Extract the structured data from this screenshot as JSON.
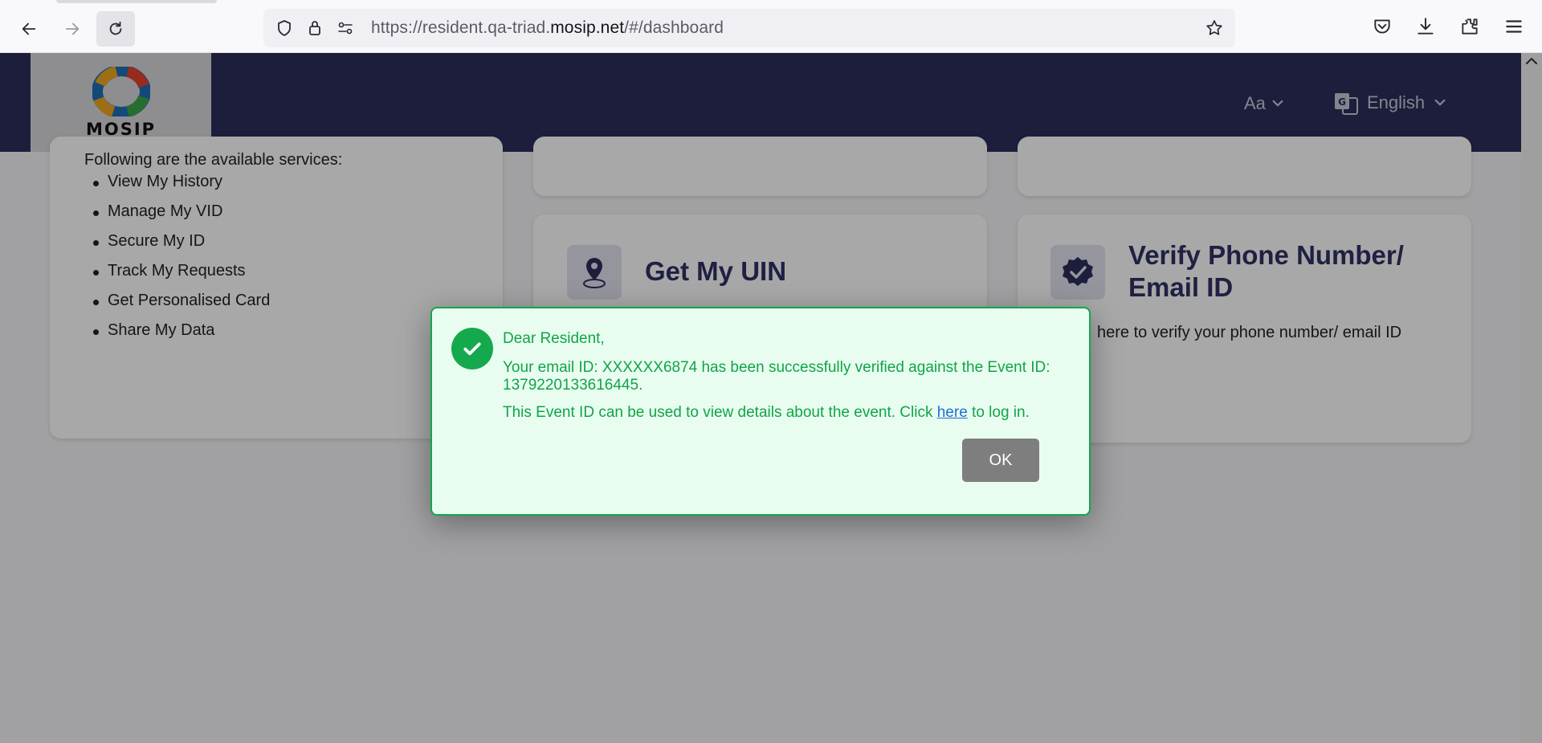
{
  "browser": {
    "url_prefix": "https://resident.qa-triad.",
    "url_domain": "mosip.net",
    "url_suffix": "/#/dashboard"
  },
  "header": {
    "logo_text": "MOSIP",
    "font_size_label": "Aa",
    "language_label": "English"
  },
  "services": {
    "intro": "Following are the available services:",
    "items": [
      "View My History",
      "Manage My VID",
      "Secure My ID",
      "Track My Requests",
      "Get Personalised Card",
      "Share My Data"
    ]
  },
  "cards": {
    "get_uin_title": "Get My UIN",
    "verify_title_line1": "Verify Phone Number/",
    "verify_title_line2": "Email ID",
    "verify_desc": "here to verify your phone number/ email ID"
  },
  "dialog": {
    "greeting": "Dear Resident,",
    "message_line1": "Your email ID: XXXXXX6874 has been successfully verified against the Event ID:",
    "message_line2": "1379220133616445.",
    "info_before_link": "This Event ID can be used to view details about the event. Click ",
    "link_text": "here",
    "info_after_link": " to log in.",
    "ok_label": "OK"
  },
  "colors": {
    "header_bg": "#2c2e5c",
    "dialog_bg": "#e8fdf0",
    "dialog_text": "#11a447",
    "ok_button": "#7e7e7e"
  }
}
